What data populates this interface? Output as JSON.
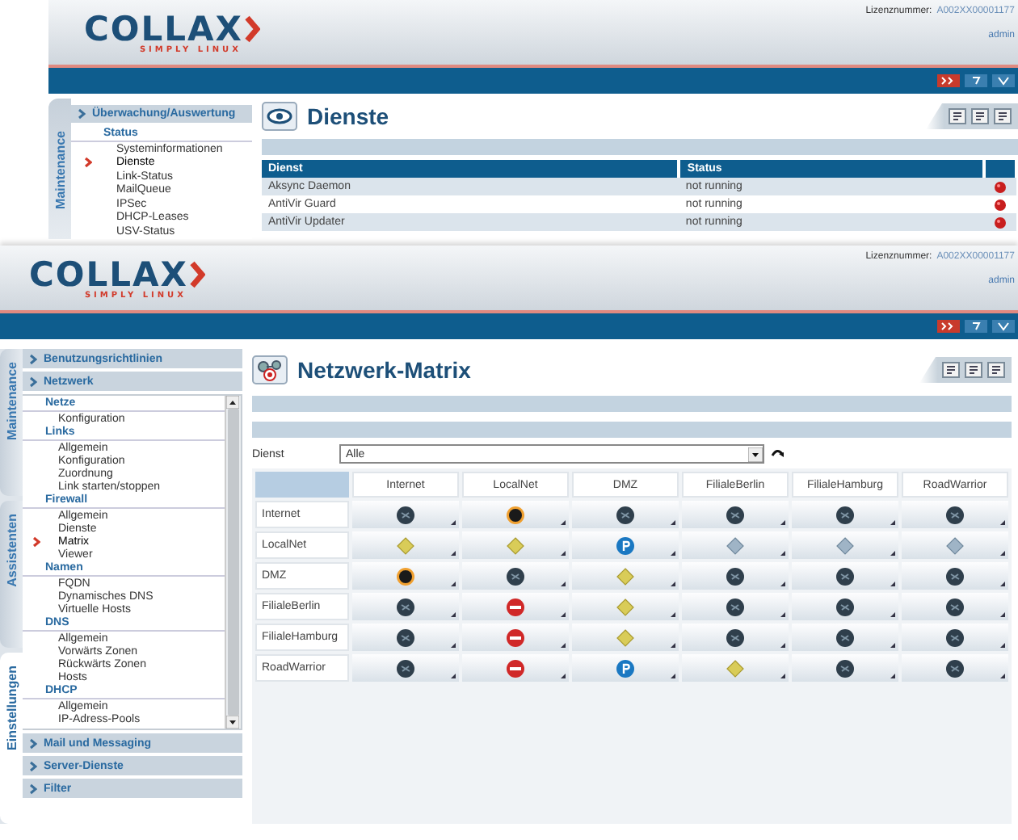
{
  "back_window": {
    "header": {
      "logo": "COLLAX",
      "tagline": "SIMPLY LINUX",
      "license_label": "Lizenznummer:",
      "license_number": "A002XX00001177",
      "user": "admin"
    },
    "sidebar": {
      "vertical_tab": "Maintenance",
      "section": "Überwachung/Auswertung",
      "group": "Status",
      "items": [
        {
          "label": "Systeminformationen",
          "selected": false
        },
        {
          "label": "Dienste",
          "selected": true
        },
        {
          "label": "Link-Status",
          "selected": false
        },
        {
          "label": "MailQueue",
          "selected": false
        },
        {
          "label": "IPSec",
          "selected": false
        },
        {
          "label": "DHCP-Leases",
          "selected": false
        },
        {
          "label": "USV-Status",
          "selected": false
        }
      ]
    },
    "page_title": "Dienste",
    "table": {
      "columns": [
        "Dienst",
        "Status"
      ],
      "rows": [
        {
          "dienst": "Aksync Daemon",
          "status": "not running"
        },
        {
          "dienst": "AntiVir Guard",
          "status": "not running"
        },
        {
          "dienst": "AntiVir Updater",
          "status": "not running"
        }
      ]
    }
  },
  "front_window": {
    "header": {
      "logo": "COLLAX",
      "tagline": "SIMPLY LINUX",
      "license_label": "Lizenznummer:",
      "license_number": "A002XX00001177",
      "user": "admin"
    },
    "sidebar": {
      "vertical_tabs": [
        {
          "label": "Maintenance",
          "selected": false
        },
        {
          "label": "Assistenten",
          "selected": false
        },
        {
          "label": "Einstellungen",
          "selected": true
        }
      ],
      "sections_top": [
        "Benutzungsrichtlinien",
        "Netzwerk"
      ],
      "groups": [
        {
          "title": "Netze",
          "items": [
            {
              "label": "Konfiguration",
              "selected": false
            }
          ]
        },
        {
          "title": "Links",
          "items": [
            {
              "label": "Allgemein",
              "selected": false
            },
            {
              "label": "Konfiguration",
              "selected": false
            },
            {
              "label": "Zuordnung",
              "selected": false
            },
            {
              "label": "Link starten/stoppen",
              "selected": false
            }
          ]
        },
        {
          "title": "Firewall",
          "items": [
            {
              "label": "Allgemein",
              "selected": false
            },
            {
              "label": "Dienste",
              "selected": false
            },
            {
              "label": "Matrix",
              "selected": true
            },
            {
              "label": "Viewer",
              "selected": false
            }
          ]
        },
        {
          "title": "Namen",
          "items": [
            {
              "label": "FQDN",
              "selected": false
            },
            {
              "label": "Dynamisches DNS",
              "selected": false
            },
            {
              "label": "Virtuelle Hosts",
              "selected": false
            }
          ]
        },
        {
          "title": "DNS",
          "items": [
            {
              "label": "Allgemein",
              "selected": false
            },
            {
              "label": "Vorwärts Zonen",
              "selected": false
            },
            {
              "label": "Rückwärts Zonen",
              "selected": false
            },
            {
              "label": "Hosts",
              "selected": false
            }
          ]
        },
        {
          "title": "DHCP",
          "items": [
            {
              "label": "Allgemein",
              "selected": false
            },
            {
              "label": "IP-Adress-Pools",
              "selected": false
            }
          ]
        }
      ],
      "sections_bottom": [
        "Mail und Messaging",
        "Server-Dienste",
        "Filter"
      ]
    },
    "page_title": "Netzwerk-Matrix",
    "filter": {
      "label": "Dienst",
      "value": "Alle"
    },
    "matrix": {
      "columns": [
        "Internet",
        "LocalNet",
        "DMZ",
        "FilialeBerlin",
        "FilialeHamburg",
        "RoadWarrior"
      ],
      "rows": [
        {
          "label": "Internet",
          "cells": [
            {
              "kind": "dark"
            },
            {
              "kind": "orange"
            },
            {
              "kind": "dark"
            },
            {
              "kind": "dark"
            },
            {
              "kind": "dark"
            },
            {
              "kind": "dark"
            }
          ]
        },
        {
          "label": "LocalNet",
          "cells": [
            {
              "kind": "diamond"
            },
            {
              "kind": "diamond"
            },
            {
              "kind": "proxy"
            },
            {
              "kind": "diamond-pale"
            },
            {
              "kind": "diamond-pale"
            },
            {
              "kind": "diamond-pale"
            }
          ]
        },
        {
          "label": "DMZ",
          "cells": [
            {
              "kind": "orange"
            },
            {
              "kind": "dark"
            },
            {
              "kind": "diamond"
            },
            {
              "kind": "dark"
            },
            {
              "kind": "dark"
            },
            {
              "kind": "dark"
            }
          ]
        },
        {
          "label": "FilialeBerlin",
          "cells": [
            {
              "kind": "dark"
            },
            {
              "kind": "deny"
            },
            {
              "kind": "diamond"
            },
            {
              "kind": "dark"
            },
            {
              "kind": "dark"
            },
            {
              "kind": "dark"
            }
          ]
        },
        {
          "label": "FilialeHamburg",
          "cells": [
            {
              "kind": "dark"
            },
            {
              "kind": "deny"
            },
            {
              "kind": "diamond"
            },
            {
              "kind": "dark"
            },
            {
              "kind": "dark"
            },
            {
              "kind": "dark"
            }
          ]
        },
        {
          "label": "RoadWarrior",
          "cells": [
            {
              "kind": "dark"
            },
            {
              "kind": "deny"
            },
            {
              "kind": "proxy"
            },
            {
              "kind": "diamond"
            },
            {
              "kind": "dark"
            },
            {
              "kind": "dark"
            }
          ]
        }
      ]
    }
  }
}
